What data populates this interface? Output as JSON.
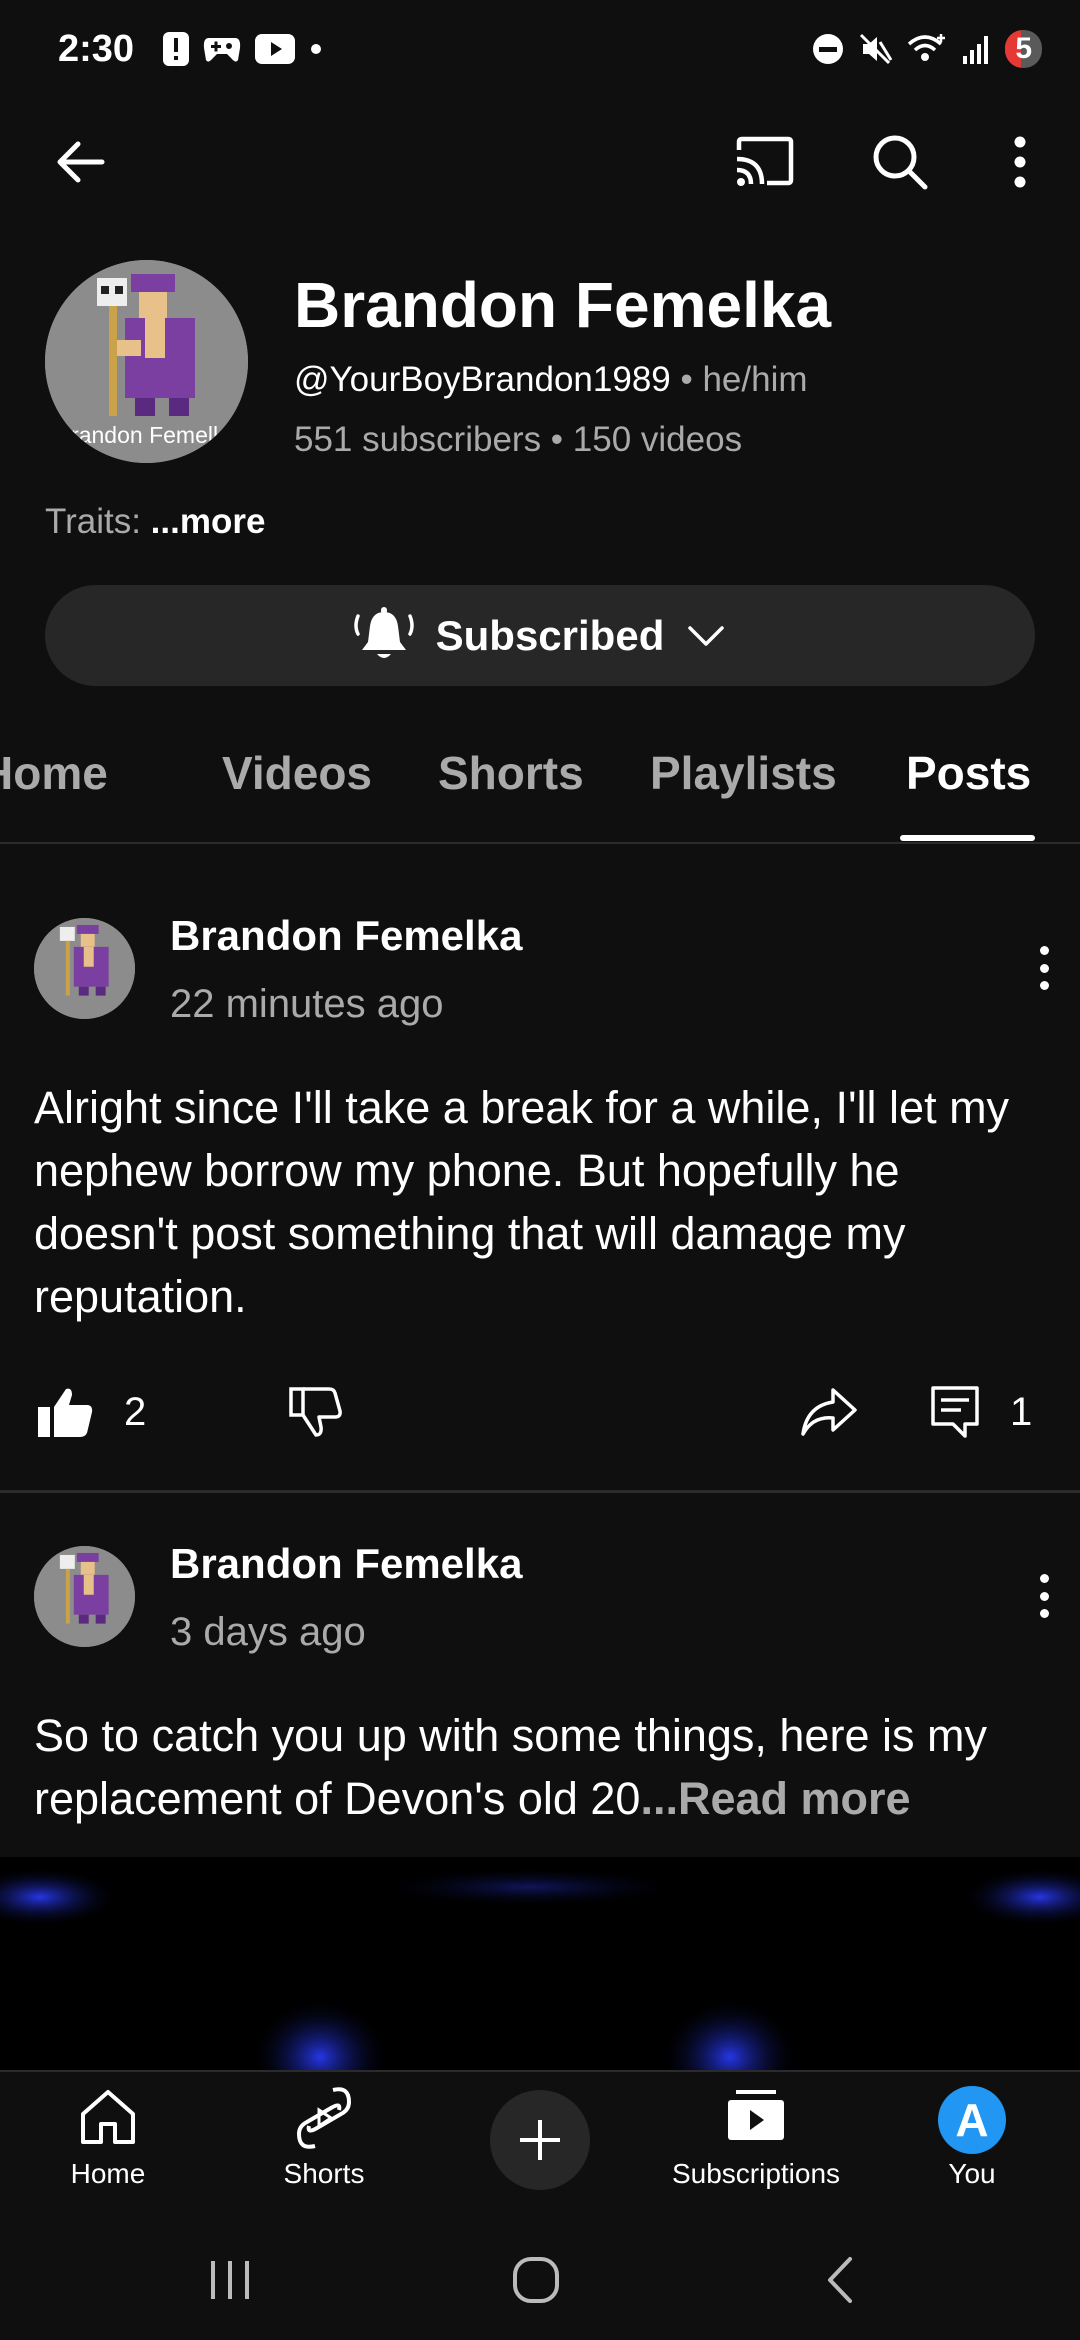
{
  "status_bar": {
    "time": "2:30",
    "battery": "5"
  },
  "app_bar": {
    "icons": [
      "back-arrow-icon",
      "cast-icon",
      "search-icon",
      "more-vert-icon"
    ]
  },
  "channel": {
    "name": "Brandon Femelka",
    "handle": "@YourBoyBrandon1989",
    "separator": " • ",
    "pronouns": "he/him",
    "subscribers": "551 subscribers",
    "videos": "150 videos",
    "avatar_text": "Brandon Femelka",
    "traits_label": "Traits: ",
    "traits_more": "...more"
  },
  "subscribe": {
    "label": "Subscribed"
  },
  "tabs": [
    {
      "label": "Home"
    },
    {
      "label": "Videos"
    },
    {
      "label": "Shorts"
    },
    {
      "label": "Playlists"
    },
    {
      "label": "Posts",
      "active": true
    }
  ],
  "posts": [
    {
      "author": "Brandon Femelka",
      "time": "22 minutes ago",
      "text": "Alright since I'll take a break for a while, I'll let my nephew borrow my phone. But hopefully he doesn't post something that will damage my reputation.",
      "likes": "2",
      "comments": "1"
    },
    {
      "author": "Brandon Femelka",
      "time": "3 days ago",
      "text": "So to catch you up with some things, here is my replacement of Devon's old 20",
      "ellipsis": "...",
      "read_more": "Read more"
    }
  ],
  "bottom_nav": [
    {
      "label": "Home",
      "icon": "home-icon"
    },
    {
      "label": "Shorts",
      "icon": "shorts-icon"
    },
    {
      "label": "",
      "icon": "create-plus-icon"
    },
    {
      "label": "Subscriptions",
      "icon": "subscriptions-icon"
    },
    {
      "label": "You",
      "icon": "you-avatar"
    }
  ],
  "you_avatar_letter": "A",
  "colors": {
    "background": "#0f0f0f",
    "surface": "#272727",
    "muted_text": "#aaaaaa",
    "you_avatar": "#2196f3",
    "battery_low": "#e53935"
  }
}
